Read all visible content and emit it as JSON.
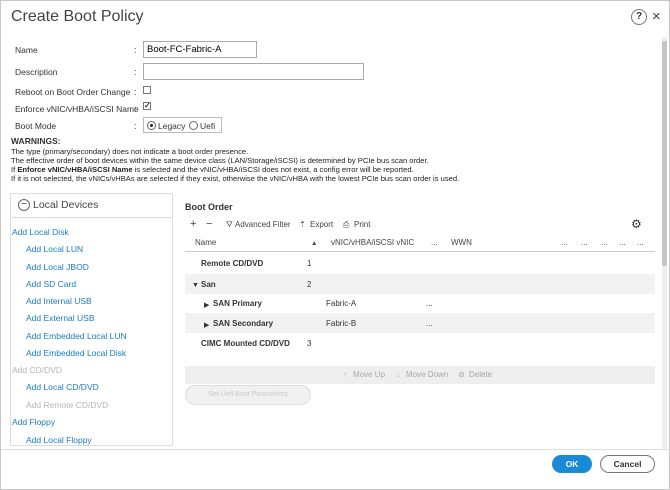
{
  "dialog": {
    "title": "Create Boot Policy",
    "help": "?",
    "close": "×"
  },
  "form": {
    "name_label": "Name",
    "name_value": "Boot-FC-Fabric-A",
    "description_label": "Description",
    "description_value": "",
    "reboot_label": "Reboot on Boot Order Change",
    "reboot_checked": false,
    "enforce_label": "Enforce vNIC/vHBA/iSCSI Name",
    "enforce_checked": true,
    "boot_mode_label": "Boot Mode",
    "boot_mode_options": [
      "Legacy",
      "Uefi"
    ],
    "boot_mode_selected": "Legacy",
    "colon": ":"
  },
  "warnings": {
    "title": "WARNINGS:",
    "line1": "The type (primary/secondary) does not indicate a boot order presence.",
    "line2": "The effective order of boot devices within the same device class (LAN/Storage/iSCSI) is determined by PCIe bus scan order.",
    "line3_pre": "If ",
    "line3_bold": "Enforce vNIC/vHBA/iSCSI Name",
    "line3_post": " is selected and the vNIC/vHBA/iSCSI does not exist, a config error will be reported.",
    "line4": "If it is not selected, the vNICs/vHBAs are selected if they exist, otherwise the vNIC/vHBA with the lowest PCIe bus scan order is used."
  },
  "local_devices": {
    "header": "Local Devices",
    "items": [
      {
        "label": "Add Local Disk",
        "indent": false,
        "disabled": false
      },
      {
        "label": "Add Local LUN",
        "indent": true,
        "disabled": false
      },
      {
        "label": "Add Local JBOD",
        "indent": true,
        "disabled": false
      },
      {
        "label": "Add SD Card",
        "indent": true,
        "disabled": false
      },
      {
        "label": "Add Internal USB",
        "indent": true,
        "disabled": false
      },
      {
        "label": "Add External USB",
        "indent": true,
        "disabled": false
      },
      {
        "label": "Add Embedded Local LUN",
        "indent": true,
        "disabled": false
      },
      {
        "label": "Add Embedded Local Disk",
        "indent": true,
        "disabled": false
      },
      {
        "label": "Add CD/DVD",
        "indent": false,
        "disabled": true
      },
      {
        "label": "Add Local CD/DVD",
        "indent": true,
        "disabled": false
      },
      {
        "label": "Add Remote CD/DVD",
        "indent": true,
        "disabled": true
      },
      {
        "label": "Add Floppy",
        "indent": false,
        "disabled": false
      },
      {
        "label": "Add Local Floppy",
        "indent": true,
        "disabled": false
      }
    ]
  },
  "boot_order": {
    "title": "Boot Order",
    "toolbar": {
      "add": "+",
      "remove": "−",
      "advanced_filter": "Advanced Filter",
      "export": "Export",
      "print": "Print"
    },
    "columns": {
      "name": "Name",
      "order_sort": "▲",
      "vnic": "vNIC/vHBA/iSCSI vNIC",
      "ellipsis": "...",
      "wwn": "WWN"
    },
    "rows": [
      {
        "name": "Remote CD/DVD",
        "order": "1",
        "vnic": "",
        "extra": ""
      },
      {
        "name": "San",
        "order": "2",
        "vnic": "",
        "extra": ""
      },
      {
        "name": "SAN Primary",
        "order": "",
        "vnic": "Fabric-A",
        "extra": "..."
      },
      {
        "name": "SAN Secondary",
        "order": "",
        "vnic": "Fabric-B",
        "extra": "..."
      },
      {
        "name": "CIMC Mounted CD/DVD",
        "order": "3",
        "vnic": "",
        "extra": ""
      }
    ],
    "actions": {
      "move_up": "Move Up",
      "move_down": "Move Down",
      "delete": "Delete",
      "set_uefi": "Set Uefi Boot Parameters"
    }
  },
  "footer": {
    "ok": "OK",
    "cancel": "Cancel"
  },
  "colors": {
    "primary_blue": "#1a8ad6",
    "link_blue": "#1a7bbf",
    "disabled_gray": "#b5b5b5"
  }
}
